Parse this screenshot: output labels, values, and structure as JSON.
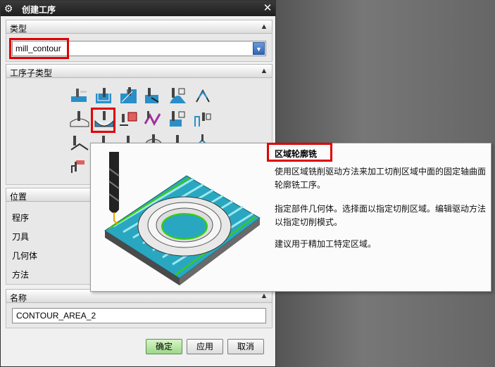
{
  "dialog": {
    "title": "创建工序"
  },
  "type_section": {
    "header": "类型",
    "selected": "mill_contour"
  },
  "subtype_section": {
    "header": "工序子类型"
  },
  "location_section": {
    "header": "位置",
    "fields": [
      "程序",
      "刀具",
      "几何体",
      "方法"
    ]
  },
  "name_section": {
    "header": "名称",
    "value": "CONTOUR_AREA_2"
  },
  "buttons": {
    "ok": "确定",
    "apply": "应用",
    "cancel": "取消"
  },
  "tooltip": {
    "title": "区域轮廓铣",
    "lines": [
      "使用区域铣削驱动方法来加工切削区域中面的固定轴曲面",
      "轮廓铣工序。",
      "指定部件几何体。选择面以指定切削区域。编辑驱动方法",
      "以指定切削模式。",
      "建议用于精加工特定区域。"
    ]
  },
  "colors": {
    "highlight": "#e00000",
    "ok_button": "#9dd88a",
    "title_bar": "#1e1e1e"
  }
}
